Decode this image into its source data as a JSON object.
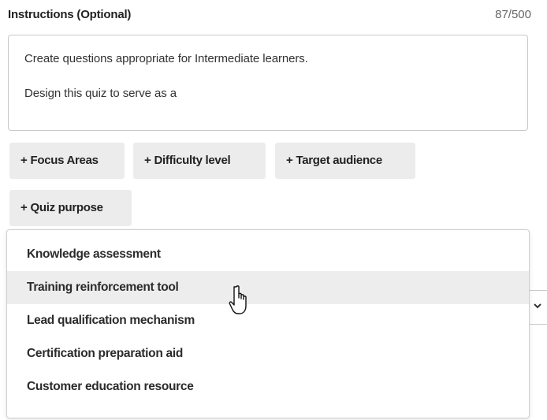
{
  "instructions": {
    "label": "Instructions (Optional)",
    "char_count": "87/500",
    "value": "Create questions appropriate for Intermediate learners.\n\nDesign this quiz to serve as a"
  },
  "chips": [
    {
      "plus": "+",
      "label": "Focus Areas"
    },
    {
      "plus": "+",
      "label": "Difficulty level"
    },
    {
      "plus": "+",
      "label": "Target audience"
    },
    {
      "plus": "+",
      "label": "Quiz purpose"
    }
  ],
  "dropdown": {
    "options": [
      {
        "label": "Knowledge assessment"
      },
      {
        "label": "Training reinforcement tool"
      },
      {
        "label": "Lead qualification mechanism"
      },
      {
        "label": "Certification preparation aid"
      },
      {
        "label": "Customer education resource"
      }
    ],
    "hovered_index": 1
  },
  "icons": {
    "select_chevron": "chevron-down-icon",
    "cursor": "hand-pointer-icon"
  }
}
